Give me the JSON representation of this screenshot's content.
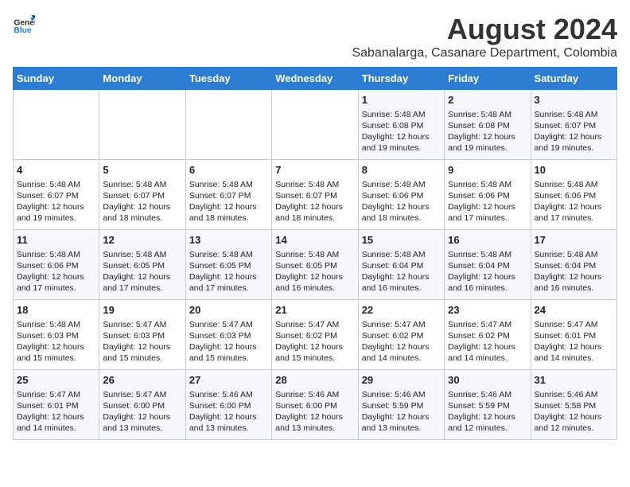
{
  "header": {
    "logo_line1": "General",
    "logo_line2": "Blue",
    "title": "August 2024",
    "subtitle": "Sabanalarga, Casanare Department, Colombia"
  },
  "weekdays": [
    "Sunday",
    "Monday",
    "Tuesday",
    "Wednesday",
    "Thursday",
    "Friday",
    "Saturday"
  ],
  "weeks": [
    [
      {
        "day": "",
        "info": ""
      },
      {
        "day": "",
        "info": ""
      },
      {
        "day": "",
        "info": ""
      },
      {
        "day": "",
        "info": ""
      },
      {
        "day": "1",
        "info": "Sunrise: 5:48 AM\nSunset: 6:08 PM\nDaylight: 12 hours\nand 19 minutes."
      },
      {
        "day": "2",
        "info": "Sunrise: 5:48 AM\nSunset: 6:08 PM\nDaylight: 12 hours\nand 19 minutes."
      },
      {
        "day": "3",
        "info": "Sunrise: 5:48 AM\nSunset: 6:07 PM\nDaylight: 12 hours\nand 19 minutes."
      }
    ],
    [
      {
        "day": "4",
        "info": "Sunrise: 5:48 AM\nSunset: 6:07 PM\nDaylight: 12 hours\nand 19 minutes."
      },
      {
        "day": "5",
        "info": "Sunrise: 5:48 AM\nSunset: 6:07 PM\nDaylight: 12 hours\nand 18 minutes."
      },
      {
        "day": "6",
        "info": "Sunrise: 5:48 AM\nSunset: 6:07 PM\nDaylight: 12 hours\nand 18 minutes."
      },
      {
        "day": "7",
        "info": "Sunrise: 5:48 AM\nSunset: 6:07 PM\nDaylight: 12 hours\nand 18 minutes."
      },
      {
        "day": "8",
        "info": "Sunrise: 5:48 AM\nSunset: 6:06 PM\nDaylight: 12 hours\nand 18 minutes."
      },
      {
        "day": "9",
        "info": "Sunrise: 5:48 AM\nSunset: 6:06 PM\nDaylight: 12 hours\nand 17 minutes."
      },
      {
        "day": "10",
        "info": "Sunrise: 5:48 AM\nSunset: 6:06 PM\nDaylight: 12 hours\nand 17 minutes."
      }
    ],
    [
      {
        "day": "11",
        "info": "Sunrise: 5:48 AM\nSunset: 6:06 PM\nDaylight: 12 hours\nand 17 minutes."
      },
      {
        "day": "12",
        "info": "Sunrise: 5:48 AM\nSunset: 6:05 PM\nDaylight: 12 hours\nand 17 minutes."
      },
      {
        "day": "13",
        "info": "Sunrise: 5:48 AM\nSunset: 6:05 PM\nDaylight: 12 hours\nand 17 minutes."
      },
      {
        "day": "14",
        "info": "Sunrise: 5:48 AM\nSunset: 6:05 PM\nDaylight: 12 hours\nand 16 minutes."
      },
      {
        "day": "15",
        "info": "Sunrise: 5:48 AM\nSunset: 6:04 PM\nDaylight: 12 hours\nand 16 minutes."
      },
      {
        "day": "16",
        "info": "Sunrise: 5:48 AM\nSunset: 6:04 PM\nDaylight: 12 hours\nand 16 minutes."
      },
      {
        "day": "17",
        "info": "Sunrise: 5:48 AM\nSunset: 6:04 PM\nDaylight: 12 hours\nand 16 minutes."
      }
    ],
    [
      {
        "day": "18",
        "info": "Sunrise: 5:48 AM\nSunset: 6:03 PM\nDaylight: 12 hours\nand 15 minutes."
      },
      {
        "day": "19",
        "info": "Sunrise: 5:47 AM\nSunset: 6:03 PM\nDaylight: 12 hours\nand 15 minutes."
      },
      {
        "day": "20",
        "info": "Sunrise: 5:47 AM\nSunset: 6:03 PM\nDaylight: 12 hours\nand 15 minutes."
      },
      {
        "day": "21",
        "info": "Sunrise: 5:47 AM\nSunset: 6:02 PM\nDaylight: 12 hours\nand 15 minutes."
      },
      {
        "day": "22",
        "info": "Sunrise: 5:47 AM\nSunset: 6:02 PM\nDaylight: 12 hours\nand 14 minutes."
      },
      {
        "day": "23",
        "info": "Sunrise: 5:47 AM\nSunset: 6:02 PM\nDaylight: 12 hours\nand 14 minutes."
      },
      {
        "day": "24",
        "info": "Sunrise: 5:47 AM\nSunset: 6:01 PM\nDaylight: 12 hours\nand 14 minutes."
      }
    ],
    [
      {
        "day": "25",
        "info": "Sunrise: 5:47 AM\nSunset: 6:01 PM\nDaylight: 12 hours\nand 14 minutes."
      },
      {
        "day": "26",
        "info": "Sunrise: 5:47 AM\nSunset: 6:00 PM\nDaylight: 12 hours\nand 13 minutes."
      },
      {
        "day": "27",
        "info": "Sunrise: 5:46 AM\nSunset: 6:00 PM\nDaylight: 12 hours\nand 13 minutes."
      },
      {
        "day": "28",
        "info": "Sunrise: 5:46 AM\nSunset: 6:00 PM\nDaylight: 12 hours\nand 13 minutes."
      },
      {
        "day": "29",
        "info": "Sunrise: 5:46 AM\nSunset: 5:59 PM\nDaylight: 12 hours\nand 13 minutes."
      },
      {
        "day": "30",
        "info": "Sunrise: 5:46 AM\nSunset: 5:59 PM\nDaylight: 12 hours\nand 12 minutes."
      },
      {
        "day": "31",
        "info": "Sunrise: 5:46 AM\nSunset: 5:58 PM\nDaylight: 12 hours\nand 12 minutes."
      }
    ]
  ]
}
